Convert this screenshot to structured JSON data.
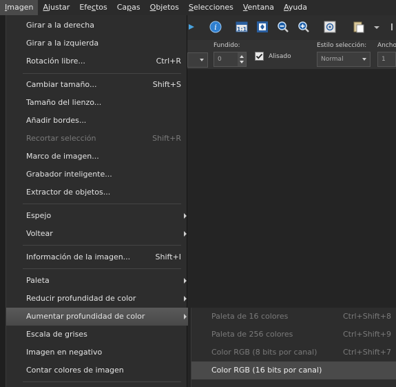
{
  "menubar": {
    "items": [
      {
        "pre": "",
        "u": "I",
        "post": "magen"
      },
      {
        "pre": "",
        "u": "A",
        "post": "justar"
      },
      {
        "pre": "Efe",
        "u": "c",
        "post": "tos"
      },
      {
        "pre": "Ca",
        "u": "p",
        "post": "as"
      },
      {
        "pre": "",
        "u": "O",
        "post": "bjetos"
      },
      {
        "pre": "",
        "u": "S",
        "post": "elecciones"
      },
      {
        "pre": "",
        "u": "V",
        "post": "entana"
      },
      {
        "pre": "",
        "u": "A",
        "post": "yuda"
      }
    ]
  },
  "options": {
    "fundido_label": "Fundido:",
    "fundido_value": "0",
    "alisado_label": "Alisado",
    "estilo_label": "Estilo selección:",
    "estilo_value": "Normal",
    "ancho_label": "Ancho",
    "ancho_value": "1"
  },
  "imagen_menu": [
    {
      "label": "Girar a la derecha",
      "shortcut": "",
      "disabled": false,
      "submenu": false
    },
    {
      "label": "Girar a la izquierda",
      "shortcut": "",
      "disabled": false,
      "submenu": false
    },
    {
      "label": "Rotación libre...",
      "shortcut": "Ctrl+R",
      "disabled": false,
      "submenu": false
    },
    {
      "label": "Cambiar tamaño...",
      "shortcut": "Shift+S",
      "disabled": false,
      "submenu": false
    },
    {
      "label": "Tamaño del lienzo...",
      "shortcut": "",
      "disabled": false,
      "submenu": false
    },
    {
      "label": "Añadir bordes...",
      "shortcut": "",
      "disabled": false,
      "submenu": false
    },
    {
      "label": "Recortar selección",
      "shortcut": "Shift+R",
      "disabled": true,
      "submenu": false
    },
    {
      "label": "Marco de imagen...",
      "shortcut": "",
      "disabled": false,
      "submenu": false
    },
    {
      "label": "Grabador inteligente...",
      "shortcut": "",
      "disabled": false,
      "submenu": false
    },
    {
      "label": "Extractor de objetos...",
      "shortcut": "",
      "disabled": false,
      "submenu": false
    },
    {
      "label": "Espejo",
      "shortcut": "",
      "disabled": false,
      "submenu": true
    },
    {
      "label": "Voltear",
      "shortcut": "",
      "disabled": false,
      "submenu": true
    },
    {
      "label": "Información de la imagen...",
      "shortcut": "Shift+I",
      "disabled": false,
      "submenu": false
    },
    {
      "label": "Paleta",
      "shortcut": "",
      "disabled": false,
      "submenu": true
    },
    {
      "label": "Reducir profundidad de color",
      "shortcut": "",
      "disabled": false,
      "submenu": true
    },
    {
      "label": "Aumentar profundidad de color",
      "shortcut": "",
      "disabled": false,
      "submenu": true
    },
    {
      "label": "Escala de grises",
      "shortcut": "",
      "disabled": false,
      "submenu": false
    },
    {
      "label": "Imagen en negativo",
      "shortcut": "",
      "disabled": false,
      "submenu": false
    },
    {
      "label": "Contar colores de imagen",
      "shortcut": "",
      "disabled": false,
      "submenu": false
    }
  ],
  "aumentar_submenu": [
    {
      "label": "Paleta de 16 colores",
      "shortcut": "Ctrl+Shift+8",
      "disabled": true
    },
    {
      "label": "Paleta de 256 colores",
      "shortcut": "Ctrl+Shift+9",
      "disabled": true
    },
    {
      "label": "Color RGB (8 bits por canal)",
      "shortcut": "Ctrl+Shift+7",
      "disabled": true
    },
    {
      "label": "Color RGB (16 bits por canal)",
      "shortcut": "",
      "disabled": false
    }
  ],
  "colors": {
    "menu_bg": "#2d2d2d",
    "highlight": "#4a4a4a",
    "disabled_text": "#7a7a7a"
  }
}
